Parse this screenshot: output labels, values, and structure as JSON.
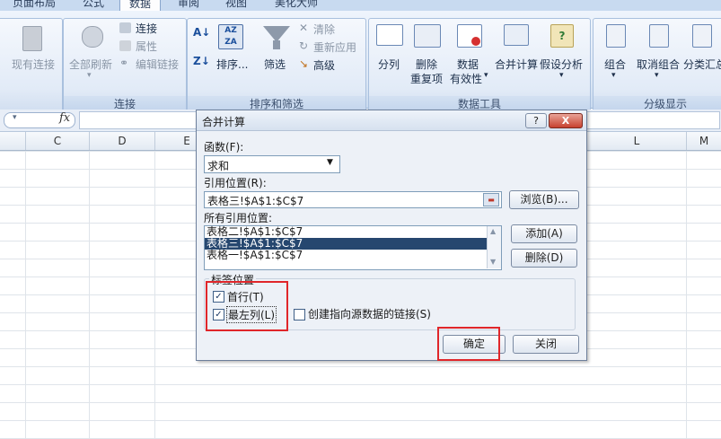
{
  "tabs": [
    "页面布局",
    "公式",
    "数据",
    "审阅",
    "视图",
    "美化大师"
  ],
  "ribbon": {
    "connections_group": {
      "existing": "现有连接",
      "refresh_all": "全部刷新",
      "connections": "连接",
      "properties": "属性",
      "edit_links": "编辑链接",
      "label": "连接"
    },
    "sort_filter_group": {
      "sort": "排序...",
      "filter": "筛选",
      "clear": "清除",
      "reapply": "重新应用",
      "advanced": "高级",
      "label": "排序和筛选"
    },
    "data_tools_group": {
      "text_to_columns": "分列",
      "remove_dup_1": "删除",
      "remove_dup_2": "重复项",
      "validation_1": "数据",
      "validation_2": "有效性",
      "consolidate": "合并计算",
      "what_if": "假设分析",
      "label": "数据工具"
    },
    "outline_group": {
      "group": "组合",
      "ungroup": "取消组合",
      "subtotal": "分类汇总",
      "label": "分级显示"
    }
  },
  "formula_bar": {
    "fx": "fx"
  },
  "columns": [
    "C",
    "D",
    "E",
    "L",
    "M"
  ],
  "dialog": {
    "title": "合并计算",
    "help": "?",
    "close": "X",
    "function_label": "函数(F):",
    "function_value": "求和",
    "reference_label": "引用位置(R):",
    "reference_value": "表格三!$A$1:$C$7",
    "browse": "浏览(B)...",
    "all_refs_label": "所有引用位置:",
    "refs": [
      "表格二!$A$1:$C$7",
      "表格三!$A$1:$C$7",
      "表格一!$A$1:$C$7"
    ],
    "add": "添加(A)",
    "delete": "删除(D)",
    "labels_section": "标签位置",
    "top_row": "首行(T)",
    "left_column": "最左列(L)",
    "create_links": "创建指向源数据的链接(S)",
    "ok": "确定",
    "close_btn": "关闭"
  }
}
